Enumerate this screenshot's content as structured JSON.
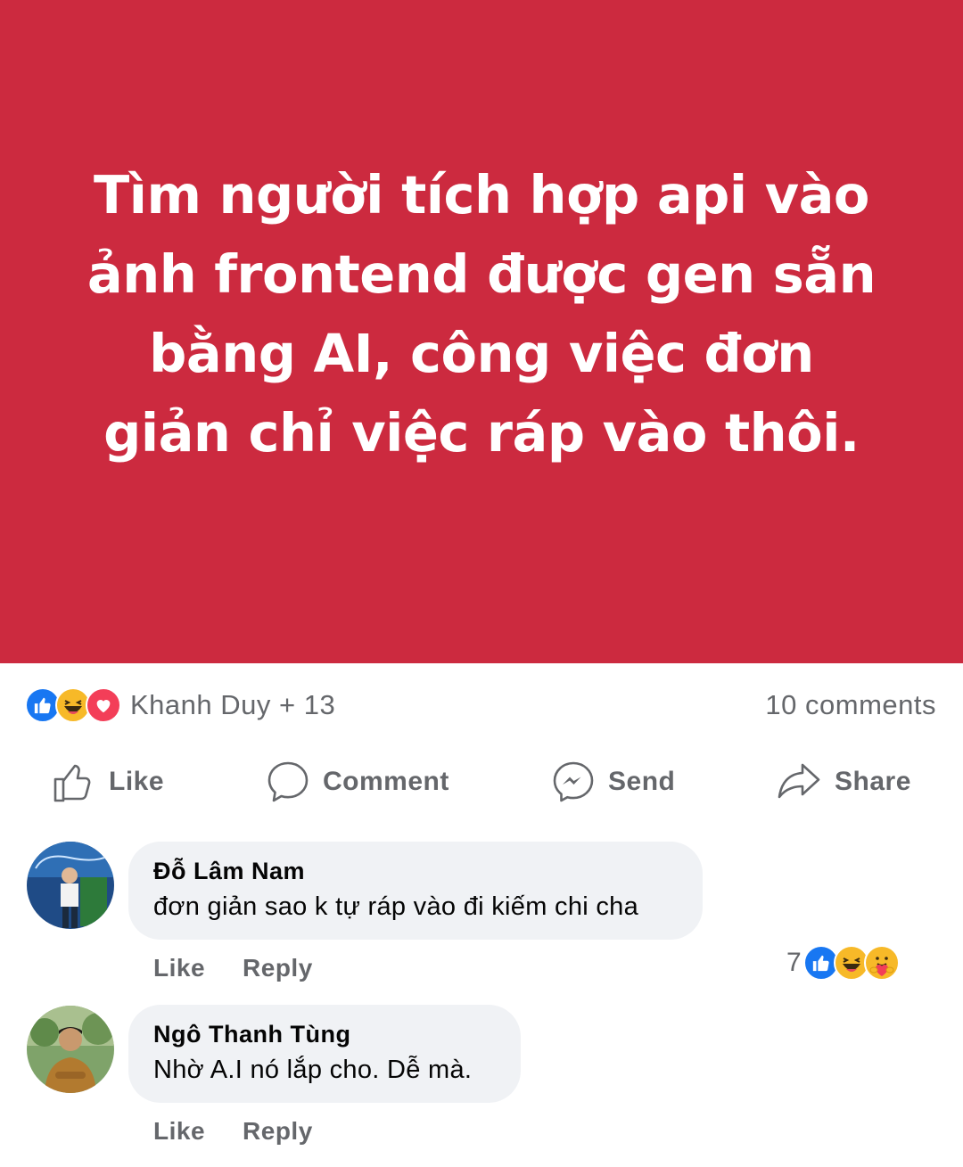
{
  "post": {
    "text": "Tìm người tích hợp api vào ảnh frontend được gen sẵn bằng AI, công việc đơn giản chỉ việc ráp vào thôi.",
    "background_color": "#cc2a3f",
    "text_color": "#ffffff"
  },
  "reactions": {
    "icons": [
      "like-icon",
      "haha-icon",
      "love-icon"
    ],
    "names": "Khanh Duy + 13",
    "comments_count": "10 comments"
  },
  "actions": {
    "like": "Like",
    "comment": "Comment",
    "send": "Send",
    "share": "Share"
  },
  "comments": [
    {
      "author": "Đỗ Lâm Nam",
      "text": "đơn giản sao k tự ráp vào đi kiếm chi cha",
      "like": "Like",
      "reply": "Reply",
      "reaction_count": "7",
      "reaction_icons": [
        "like-icon",
        "haha-icon",
        "care-icon"
      ]
    },
    {
      "author": "Ngô Thanh Tùng",
      "text": "Nhờ A.I nó lắp cho. Dễ mà.",
      "like": "Like",
      "reply": "Reply"
    }
  ],
  "colors": {
    "accent_blue": "#1877f2",
    "muted_text": "#65676b",
    "bubble_bg": "#f0f2f5",
    "love_red": "#f33e58",
    "haha_yellow": "#f7b928"
  }
}
